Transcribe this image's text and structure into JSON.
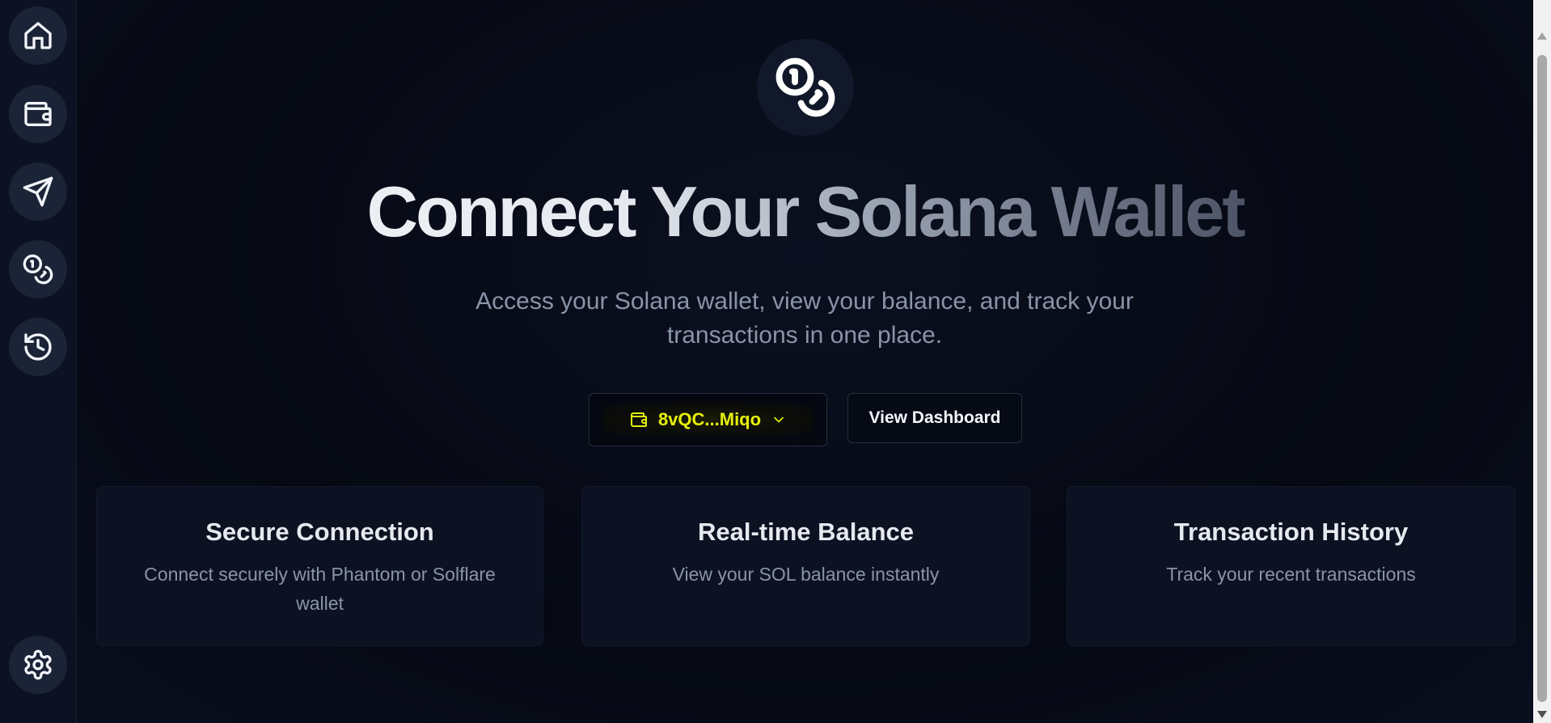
{
  "sidebar": {
    "items": [
      {
        "name": "home",
        "icon": "home-icon"
      },
      {
        "name": "wallet",
        "icon": "wallet-icon"
      },
      {
        "name": "send",
        "icon": "send-icon"
      },
      {
        "name": "coins",
        "icon": "coins-icon"
      },
      {
        "name": "history",
        "icon": "history-icon"
      }
    ],
    "settings_icon": "settings-icon"
  },
  "hero": {
    "icon": "coins-icon",
    "title": "Connect Your Solana Wallet",
    "subtitle": "Access your Solana wallet, view your balance, and track your transactions in one place."
  },
  "actions": {
    "wallet_label": "8vQC...Miqo",
    "wallet_icon": "wallet-icon",
    "wallet_color": "#e6f00c",
    "dashboard_label": "View Dashboard"
  },
  "features": [
    {
      "title": "Secure Connection",
      "desc": "Connect securely with Phantom or Solflare wallet"
    },
    {
      "title": "Real-time Balance",
      "desc": "View your SOL balance instantly"
    },
    {
      "title": "Transaction History",
      "desc": "Track your recent transactions"
    }
  ]
}
